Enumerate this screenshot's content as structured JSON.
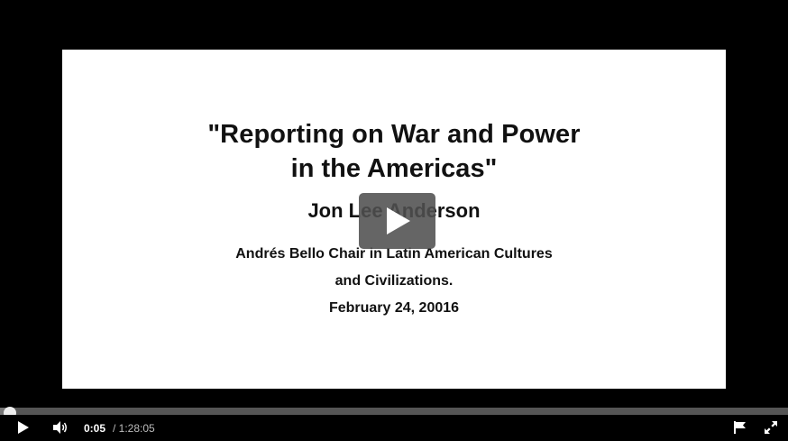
{
  "slide": {
    "title_line1": "\"Reporting on War and Power",
    "title_line2": "in the Americas\"",
    "speaker": "Jon Lee Anderson",
    "chair_line1": "Andrés Bello Chair in Latin American Cultures",
    "chair_line2": "and Civilizations.",
    "date": "February 24, 20016"
  },
  "player": {
    "current_time": "0:05",
    "duration": "/ 1:28:05",
    "progress_fraction": 0.001,
    "icons": [
      "play-icon",
      "volume-icon",
      "flag-icon",
      "fullscreen-icon",
      "big-play-icon"
    ]
  },
  "colors": {
    "background": "#000000",
    "slide": "#ffffff",
    "progress_track": "#555555"
  }
}
